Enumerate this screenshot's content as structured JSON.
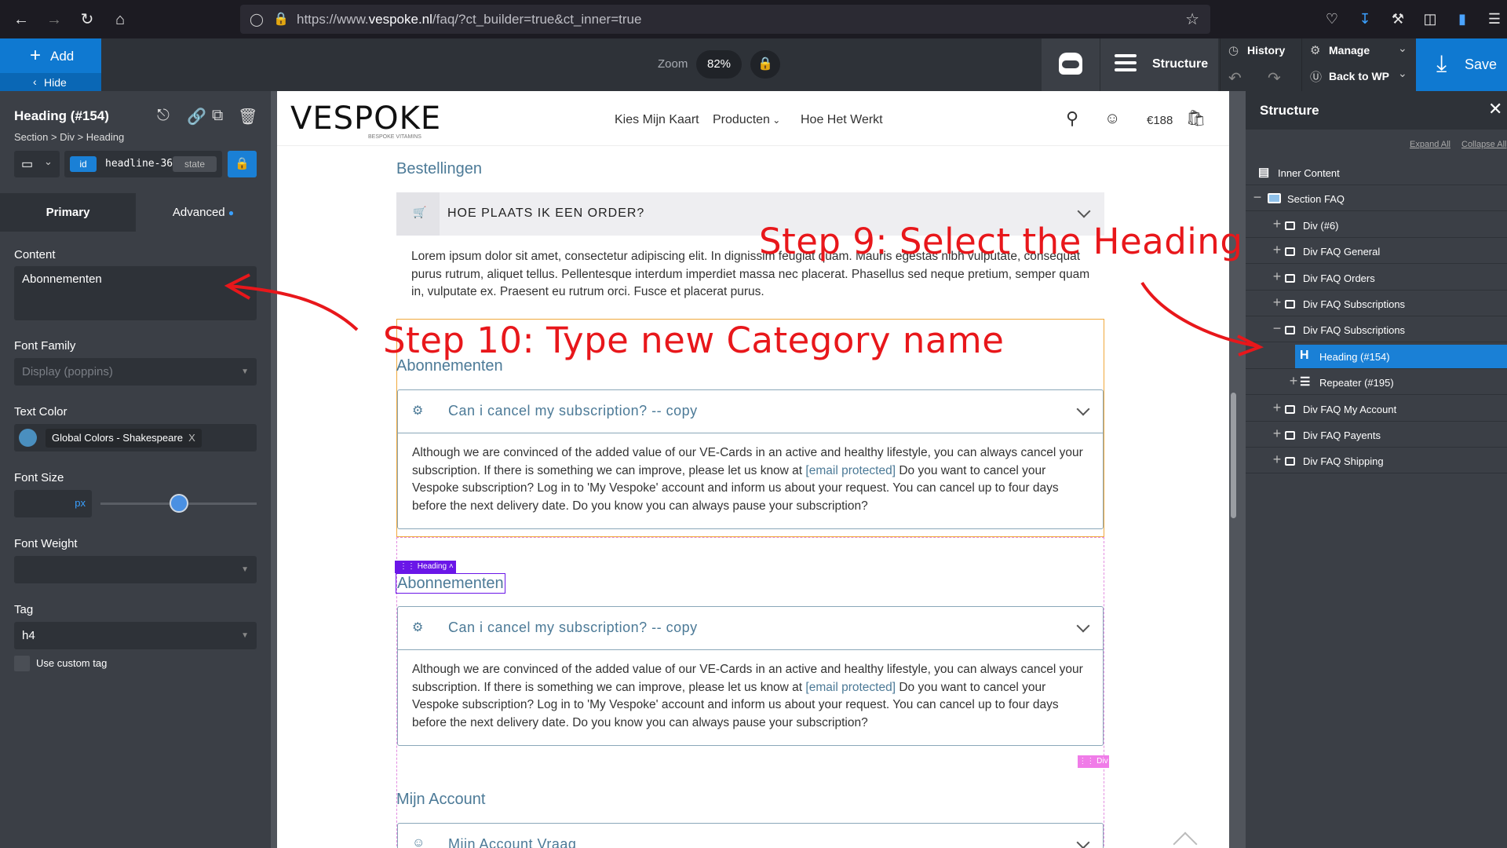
{
  "browser": {
    "url_prefix": "https://www.",
    "url_domain": "vespoke.nl",
    "url_path": "/faq/?ct_builder=true&ct_inner=true"
  },
  "toolbar": {
    "add_label": "Add",
    "hide_label": "Hide",
    "zoom_label": "Zoom",
    "zoom_value": "82%",
    "structure_label": "Structure",
    "history_label": "History",
    "manage_label": "Manage",
    "back_label": "Back to WP",
    "save_label": "Save"
  },
  "left": {
    "title": "Heading (#154)",
    "breadcrumb": "Section > Div > Heading",
    "id_badge": "id",
    "id_value": "headline-36",
    "state_label": "state",
    "tab_primary": "Primary",
    "tab_advanced": "Advanced",
    "content_label": "Content",
    "content_value": "Abonnementen",
    "font_family_label": "Font Family",
    "font_family_value": "Display (poppins)",
    "text_color_label": "Text Color",
    "text_color_value": "Global Colors - Shakespeare",
    "text_color_swatch": "#4a8fbf",
    "text_color_clear": "X",
    "font_size_label": "Font Size",
    "font_size_unit": "px",
    "font_size_slider": 0.5,
    "font_weight_label": "Font Weight",
    "tag_label": "Tag",
    "tag_value": "h4",
    "custom_tag_label": "Use custom tag"
  },
  "site": {
    "logo": "VESPOKE",
    "logo_sub": "BESPOKE VITAMINS",
    "nav": [
      "Kies Mijn Kaart",
      "Producten",
      "Hoe Het Werkt"
    ],
    "cart_price": "€188"
  },
  "content": {
    "section1": "Bestellingen",
    "q1": "HOE PLAATS IK EEN ORDER?",
    "a1": "Lorem ipsum dolor sit amet, consectetur adipiscing elit. In dignissim feugiat quam. Mauris egestas nibh vulputate, consequat purus rutrum, aliquet tellus. Pellentesque interdum imperdiet massa nec placerat. Phasellus sed neque pretium, semper quam in, vulputate ex. Praesent eu rutrum orci. Fusce et placerat purus.",
    "heading_a": "Abonnementen",
    "q2": "Can i cancel my subscription? -- copy",
    "a2_before": "Although we are convinced of the added value of our VE-Cards in an active and healthy lifestyle, you can always cancel your subscription. If there is something we can improve, please let us know at ",
    "a2_link": "[email protected]",
    "a2_after": " Do you want to cancel your Vespoke subscription? Log in to 'My Vespoke' account and inform us about your request. You can cancel up to four days before the next delivery date. Do you know you can always pause your subscription?",
    "heading_tag": "Heading",
    "heading_b": "Abonnementen",
    "q3": "Can i cancel my subscription? -- copy",
    "div_tag": "Div",
    "section3": "Mijn Account",
    "q4": "Mijn Account Vraag"
  },
  "structure": {
    "title": "Structure",
    "expand_all": "Expand All",
    "collapse_all": "Collapse All",
    "items": [
      {
        "label": "Inner Content",
        "indent": 0,
        "toggle": "",
        "icon": "list-icon"
      },
      {
        "label": "Section FAQ",
        "indent": 0,
        "toggle": "−",
        "icon": "section-icon"
      },
      {
        "label": "Div (#6)",
        "indent": 1,
        "toggle": "+",
        "icon": "div-icon"
      },
      {
        "label": "Div FAQ General",
        "indent": 1,
        "toggle": "+",
        "icon": "div-icon"
      },
      {
        "label": "Div FAQ Orders",
        "indent": 1,
        "toggle": "+",
        "icon": "div-icon"
      },
      {
        "label": "Div FAQ Subscriptions",
        "indent": 1,
        "toggle": "+",
        "icon": "div-icon"
      },
      {
        "label": "Div FAQ Subscriptions",
        "indent": 1,
        "toggle": "−",
        "icon": "div-icon"
      },
      {
        "label": "Heading (#154)",
        "indent": 2,
        "toggle": "",
        "icon": "heading-icon",
        "selected": true
      },
      {
        "label": "Repeater (#195)",
        "indent": 2,
        "toggle": "+",
        "icon": "repeater-icon"
      },
      {
        "label": "Div FAQ My Account",
        "indent": 1,
        "toggle": "+",
        "icon": "div-icon"
      },
      {
        "label": "Div FAQ Payents",
        "indent": 1,
        "toggle": "+",
        "icon": "div-icon"
      },
      {
        "label": "Div FAQ Shipping",
        "indent": 1,
        "toggle": "+",
        "icon": "div-icon"
      }
    ]
  },
  "annotations": {
    "step9": "Step 9: Select the Heading",
    "step10": "Step 10: Type new Category name",
    "color": "#e8171b"
  },
  "colors": {
    "accent": "#0f79d1",
    "selected_row": "#1a80d6",
    "heading_purple": "#6a16e8"
  }
}
